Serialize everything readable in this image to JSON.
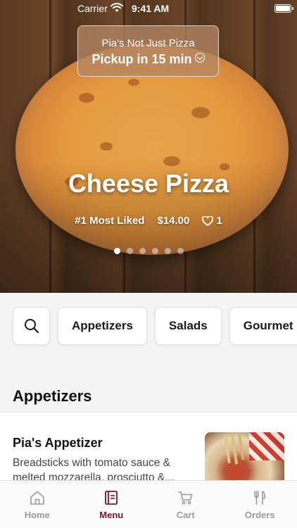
{
  "status_bar": {
    "carrier": "Carrier",
    "time": "9:41 AM"
  },
  "store": {
    "name": "Pia's Not Just Pizza",
    "pickup": "Pickup in 15 min"
  },
  "featured": {
    "title": "Cheese Pizza",
    "badge": "#1 Most Liked",
    "price": "$14.00",
    "likes": "1",
    "page_count": 6,
    "active_page": 1
  },
  "categories": [
    "Appetizers",
    "Salads",
    "Gourmet"
  ],
  "section": {
    "title": "Appetizers"
  },
  "product": {
    "name": "Pia's Appetizer",
    "description": "Breadsticks with tomato sauce & melted mozzarella, prosciutto &..."
  },
  "tabs": [
    {
      "label": "Home",
      "icon": "home-icon"
    },
    {
      "label": "Menu",
      "icon": "menu-icon",
      "active": true
    },
    {
      "label": "Cart",
      "icon": "cart-icon"
    },
    {
      "label": "Orders",
      "icon": "fork-knife-icon"
    }
  ],
  "colors": {
    "accent": "#7a1724",
    "inactive_tab": "#9a9a9e",
    "category_bg": "#f4f4f5"
  }
}
